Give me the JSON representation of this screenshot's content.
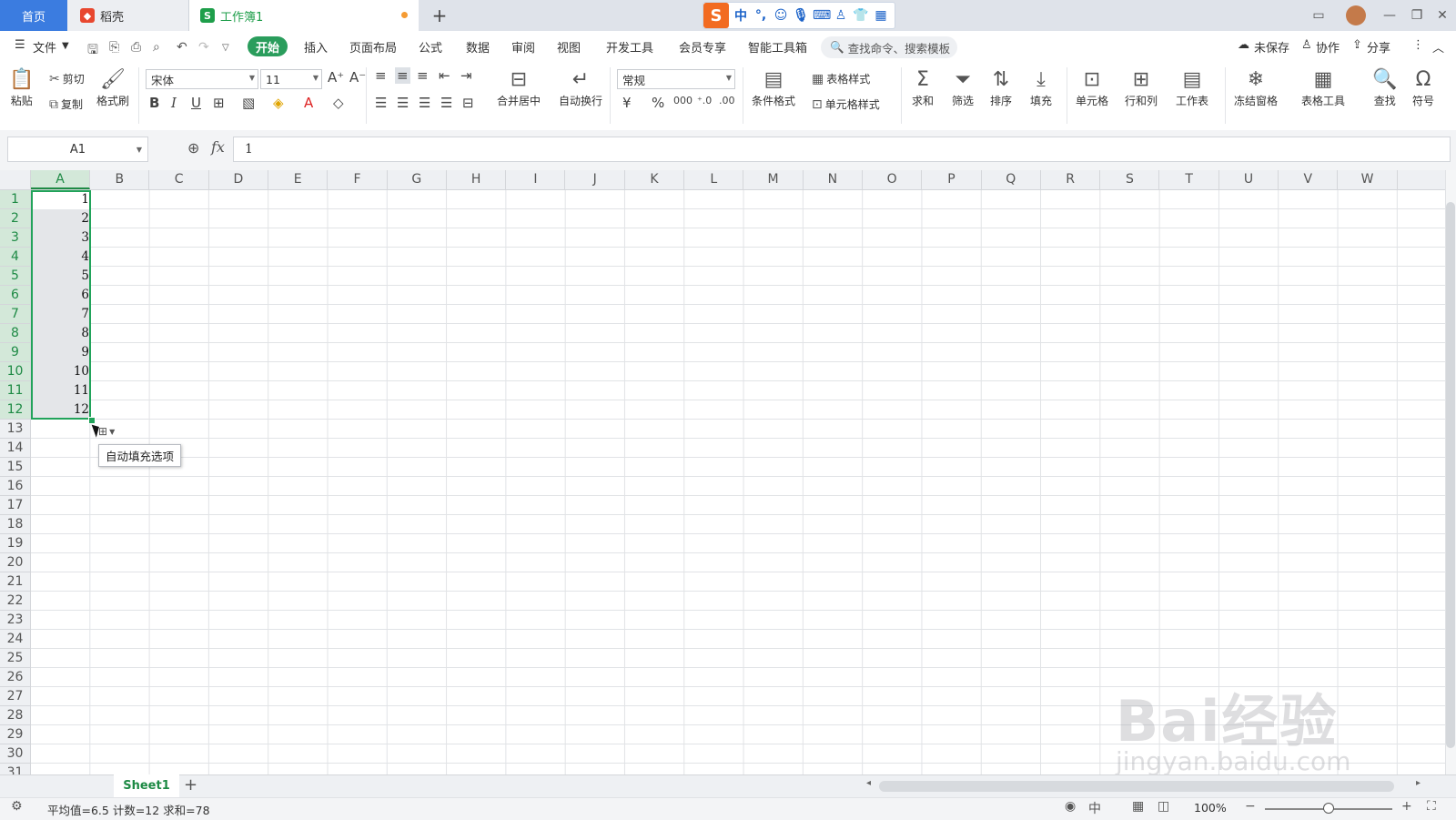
{
  "tabs": {
    "home": "首页",
    "docer": "稻壳",
    "workbook": "工作簿1",
    "sheet_icon": "S"
  },
  "ime": {
    "logo": "S",
    "mode": "中",
    "punct": "°,"
  },
  "menu": {
    "file": "文件",
    "items": [
      "开始",
      "插入",
      "页面布局",
      "公式",
      "数据",
      "审阅",
      "视图",
      "开发工具",
      "会员专享",
      "智能工具箱"
    ],
    "search_placeholder": "查找命令、搜索模板",
    "unsaved": "未保存",
    "collab": "协作",
    "share": "分享"
  },
  "ribbon": {
    "paste": "粘贴",
    "cut": "剪切",
    "copy": "复制",
    "format_painter": "格式刷",
    "font_name": "宋体",
    "font_size": "11",
    "merge_center": "合并居中",
    "auto_wrap": "自动换行",
    "number_format": "常规",
    "cond_format": "条件格式",
    "table_style": "表格样式",
    "cell_style": "单元格样式",
    "sum": "求和",
    "filter": "筛选",
    "sort": "排序",
    "fill": "填充",
    "cell": "单元格",
    "row_col": "行和列",
    "worksheet": "工作表",
    "freeze": "冻结窗格",
    "table_tools": "表格工具",
    "find": "查找",
    "symbol": "符号"
  },
  "formula_bar": {
    "name_box": "A1",
    "fx": "fx",
    "value": "1"
  },
  "grid": {
    "columns": [
      "A",
      "B",
      "C",
      "D",
      "E",
      "F",
      "G",
      "H",
      "I",
      "J",
      "K",
      "L",
      "M",
      "N",
      "O",
      "P",
      "Q",
      "R",
      "S",
      "T",
      "U",
      "V",
      "W"
    ],
    "rows": [
      "1",
      "2",
      "3",
      "4",
      "5",
      "6",
      "7",
      "8",
      "9",
      "10",
      "11",
      "12",
      "13",
      "14",
      "15",
      "16",
      "17",
      "18",
      "19",
      "20",
      "21",
      "22",
      "23",
      "24",
      "25",
      "26",
      "27",
      "28",
      "29",
      "30",
      "31"
    ],
    "column_a_values": [
      "1",
      "2",
      "3",
      "4",
      "5",
      "6",
      "7",
      "8",
      "9",
      "10",
      "11",
      "12"
    ]
  },
  "autofill": {
    "tooltip": "自动填充选项"
  },
  "sheets": {
    "active": "Sheet1",
    "add": "+"
  },
  "status": {
    "summary": "平均值=6.5  计数=12  求和=78",
    "zoom": "100%"
  },
  "watermark": {
    "brand": "Bai经验",
    "url": "jingyan.baidu.com"
  },
  "colors": {
    "accent": "#21a35a",
    "tab_home": "#3b7ce0",
    "ime_logo": "#f26b21"
  }
}
